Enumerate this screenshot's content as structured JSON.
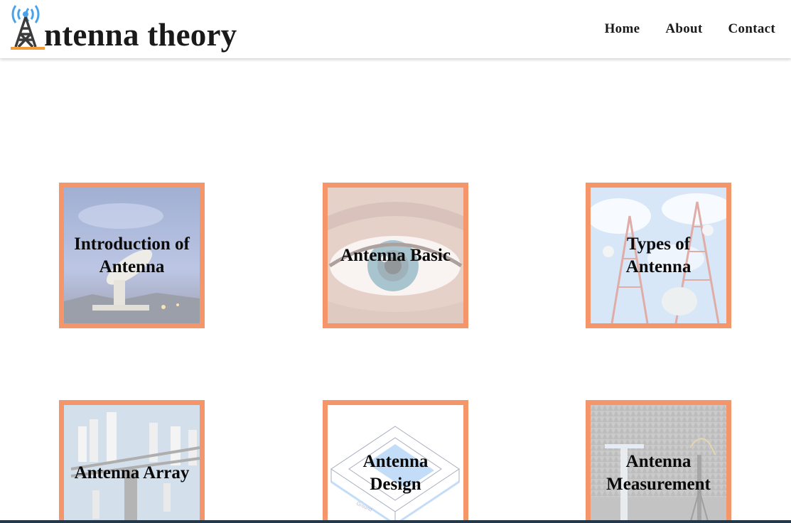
{
  "site": {
    "logo_text": "ntenna theory",
    "logo_initial": "A"
  },
  "nav": {
    "items": [
      {
        "label": "Home"
      },
      {
        "label": "About"
      },
      {
        "label": "Contact"
      }
    ]
  },
  "cards": [
    {
      "label": "Introduction of Antenna",
      "image": "satellite-dish-dusk"
    },
    {
      "label": "Antenna Basic",
      "image": "eye-closeup"
    },
    {
      "label": "Types of Antenna",
      "image": "telecom-towers"
    },
    {
      "label": "Antenna Array",
      "image": "cell-tower-panels"
    },
    {
      "label": "Antenna Design",
      "image": "patch-antenna-diagram"
    },
    {
      "label": "Antenna Measurement",
      "image": "anechoic-chamber"
    }
  ],
  "colors": {
    "card_border": "#f5956a",
    "logo_signal": "#4aa3ea",
    "logo_base": "#f39a3a",
    "footer_strip": "#24384a"
  }
}
